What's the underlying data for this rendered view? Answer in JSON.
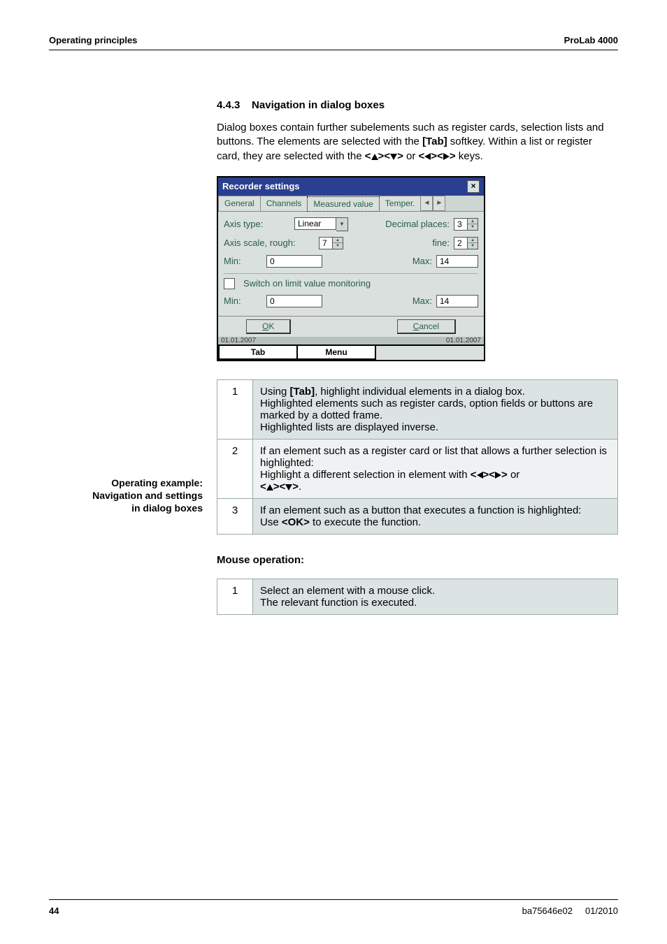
{
  "header": {
    "left": "Operating principles",
    "right": "ProLab 4000"
  },
  "section": {
    "num": "4.4.3",
    "title": "Navigation in dialog boxes",
    "para_before_tab": "Dialog boxes contain further subelements such as register cards, selection lists and buttons. The elements are selected with the ",
    "tab_key": "[Tab]",
    "para_after_tab": " softkey. Within a list or register card, they are selected with the ",
    "keys_or": " or ",
    "keys_end": " keys."
  },
  "dialog": {
    "title": "Recorder settings",
    "tabs": [
      "General",
      "Channels",
      "Measured value",
      "Temper."
    ],
    "axis_type_label": "Axis type:",
    "axis_type_value": "Linear",
    "decimal_label": "Decimal places:",
    "decimal_value": "3",
    "axis_scale_label": "Axis scale, rough:",
    "axis_scale_value": "7",
    "fine_label": "fine:",
    "fine_value": "2",
    "min_label": "Min:",
    "min_value": "0",
    "max_label": "Max:",
    "max_value": "14",
    "switch_label": "Switch on limit value monitoring",
    "min2_value": "0",
    "max2_value": "14",
    "ok": "OK",
    "cancel": "Cancel",
    "date_left": "01.01.2007",
    "date_right": "01.01.2007",
    "softkeys": [
      "Tab",
      "Menu"
    ]
  },
  "sidelabel": {
    "l1": "Operating example:",
    "l2": "Navigation and settings",
    "l3": "in dialog boxes"
  },
  "steps": [
    {
      "n": "1",
      "lines_plain": [
        "Using [Tab], highlight individual elements in a dialog box.",
        "Highlighted elements such as register cards, option fields or buttons are marked by a dotted frame.",
        "Highlighted lists are displayed inverse."
      ],
      "bold_in_first": "[Tab]"
    },
    {
      "n": "2",
      "line1": "If an element such as a register card or list that allows a further selection is highlighted:",
      "line2_before": "Highlight a different selection in element with ",
      "line2_mid_or": " or",
      "line2_end": "."
    },
    {
      "n": "3",
      "line1": "If an element such as a button that executes a function is highlighted:",
      "line2_before": "Use ",
      "ok": "<OK>",
      "line2_after": " to execute the function."
    }
  ],
  "mouse_heading": "Mouse operation:",
  "mouse_step": {
    "n": "1",
    "l1": "Select an element with a mouse click.",
    "l2": "The relevant function is executed."
  },
  "footer": {
    "page": "44",
    "doc": "ba75646e02",
    "date": "01/2010"
  }
}
